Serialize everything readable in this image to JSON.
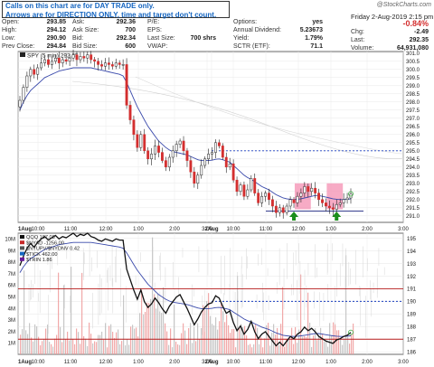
{
  "annotation": {
    "line1": "Calls on this chart are for DAY TRADE only.",
    "line2": "Arrows are for DIRECTION ONLY, time and target don't count."
  },
  "watermark": "@StockCharts.com",
  "header": {
    "date_label": "Friday  2-Aug-2019  2:15 pm",
    "pct_change": "-0.84%",
    "chg_label": "Chg:",
    "chg_value": "-2.49",
    "last_label": "Last:",
    "last_value": "292.35",
    "volume_label": "Volume:",
    "volume_value": "64,931,080"
  },
  "quote": {
    "open_label": "Open:",
    "open_value": "293.85",
    "high_label": "High:",
    "high_value": "294.12",
    "low_label": "Low:",
    "low_value": "290.90",
    "prev_label": "Prev Close:",
    "prev_value": "294.84",
    "ask_label": "Ask:",
    "ask_value": "292.36",
    "asksize_label": "Ask Size:",
    "asksize_value": "700",
    "bid_label": "Bid:",
    "bid_value": "292.34",
    "bidsize_label": "Bid Size:",
    "bidsize_value": "600",
    "pe_label": "P/E:",
    "eps_label": "EPS:",
    "lastsize_label": "Last Size:",
    "lastsize_value": "700 shrs",
    "vwap_label": "VWAP:",
    "options_label": "Options:",
    "options_value": "yes",
    "div_label": "Annual Dividend:",
    "div_value": "5.23673",
    "yield_label": "Yield:",
    "yield_value": "1.79%",
    "sctr_label": "SCTR (ETF):",
    "sctr_value": "71.1"
  },
  "chart_data": [
    {
      "type": "candlestick",
      "legend": "SPY (5 min) 292.35",
      "y_ticks": [
        291.0,
        291.5,
        292.0,
        292.5,
        293.0,
        293.5,
        294.0,
        294.5,
        295.0,
        295.5,
        296.0,
        296.5,
        297.0,
        297.5,
        298.0,
        298.5,
        299.0,
        299.5,
        300.0,
        300.5,
        301.0
      ],
      "ylim": [
        290.6,
        301.1
      ],
      "x_ticks": [
        "1Aug",
        "10:00",
        "11:00",
        "12:00",
        "1:00",
        "2:00",
        "3:00",
        "2Aug",
        "10:00",
        "11:00",
        "12:00",
        "1:00",
        "2:00",
        "3:00"
      ],
      "close": [
        298.1,
        298.9,
        299.6,
        300.0,
        299.7,
        300.1,
        300.4,
        300.6,
        300.3,
        300.5,
        300.7,
        300.4,
        300.6,
        300.5,
        300.7,
        300.9,
        300.6,
        300.8,
        300.7,
        300.9,
        300.6,
        300.5,
        300.3,
        300.2,
        300.4,
        300.3,
        300.2,
        300.4,
        300.3,
        300.3,
        297.8,
        296.9,
        296.0,
        295.2,
        296.0,
        295.0,
        294.5,
        294.8,
        295.3,
        294.9,
        294.4,
        294.0,
        294.6,
        295.0,
        295.4,
        295.6,
        295.0,
        294.4,
        293.7,
        293.0,
        293.5,
        294.1,
        294.5,
        294.8,
        294.9,
        295.5,
        295.3,
        294.6,
        294.0,
        294.2,
        293.2,
        292.5,
        292.9,
        292.2,
        292.6,
        293.3,
        292.4,
        291.8,
        292.2,
        292.4,
        292.0,
        291.6,
        291.2,
        291.5,
        291.2,
        291.6,
        292.0,
        291.8,
        292.2,
        292.4,
        292.8,
        292.5,
        292.7,
        292.4,
        292.0,
        291.8,
        291.6,
        291.5,
        291.4,
        291.7,
        291.8,
        292.0,
        292.1,
        292.35
      ],
      "ma_line": [
        297.5,
        298.0,
        298.4,
        298.7,
        298.9,
        299.1,
        299.3,
        299.5,
        299.6,
        299.7,
        299.8,
        299.9,
        299.95,
        300.0,
        300.05,
        300.1,
        300.1,
        300.1,
        300.1,
        300.1,
        300.1,
        300.05,
        300.0,
        299.95,
        299.9,
        299.85,
        299.8,
        299.75,
        299.7,
        299.6,
        299.2,
        298.7,
        298.2,
        297.7,
        297.3,
        296.9,
        296.5,
        296.2,
        295.9,
        295.6,
        295.4,
        295.2,
        295.05,
        294.95,
        294.9,
        294.85,
        294.8,
        294.75,
        294.65,
        294.55,
        294.45,
        294.4,
        294.4,
        294.4,
        294.42,
        294.48,
        294.5,
        294.45,
        294.38,
        294.3,
        294.1,
        293.9,
        293.7,
        293.5,
        293.35,
        293.25,
        293.1,
        292.95,
        292.8,
        292.7,
        292.6,
        292.45,
        292.3,
        292.2,
        292.1,
        292.05,
        292.02,
        292.0,
        292.02,
        292.05,
        292.1,
        292.15,
        292.2,
        292.25,
        292.25,
        292.2,
        292.15,
        292.1,
        292.05,
        292.02,
        292.0,
        292.0,
        292.02,
        292.05
      ],
      "resistance_dotted": 295.0,
      "support_line": 291.3,
      "highlight_ranges": [
        [
          78,
          81
        ],
        [
          87,
          90
        ]
      ],
      "up_arrows_at": [
        77,
        89
      ]
    },
    {
      "type": "line",
      "legend": [
        "QQQ 187.08",
        "$NYAD -1256.00",
        "$NYUPV/$NYDNV 0.42",
        "$TICK 462.00",
        "$TRIN 1.86"
      ],
      "y_ticks": [
        186,
        187,
        188,
        189,
        190,
        191,
        192,
        193,
        194,
        195
      ],
      "ylim": [
        185.8,
        195.4
      ],
      "volume_ticks": [
        "1M",
        "2M",
        "3M",
        "4M",
        "5M",
        "6M",
        "7M",
        "8M",
        "9M",
        "10M"
      ],
      "volume_ylim": [
        0,
        10.5
      ],
      "x_ticks": [
        "1Aug",
        "10:00",
        "11:00",
        "12:00",
        "1:00",
        "2:00",
        "3:00",
        "2Aug",
        "10:00",
        "11:00",
        "12:00",
        "1:00",
        "2:00",
        "3:00"
      ],
      "horizontal_lines": [
        191.0,
        187.0
      ],
      "dotted_line": 190.0
    }
  ],
  "colors": {
    "up": "#2e7d32",
    "down": "#d32f2f",
    "ma": "#3949ab",
    "hline": "#b71c1c",
    "dotted": "#1a3fbf",
    "highlight": "#f48fb1",
    "arrow": "#1b8e1b"
  }
}
